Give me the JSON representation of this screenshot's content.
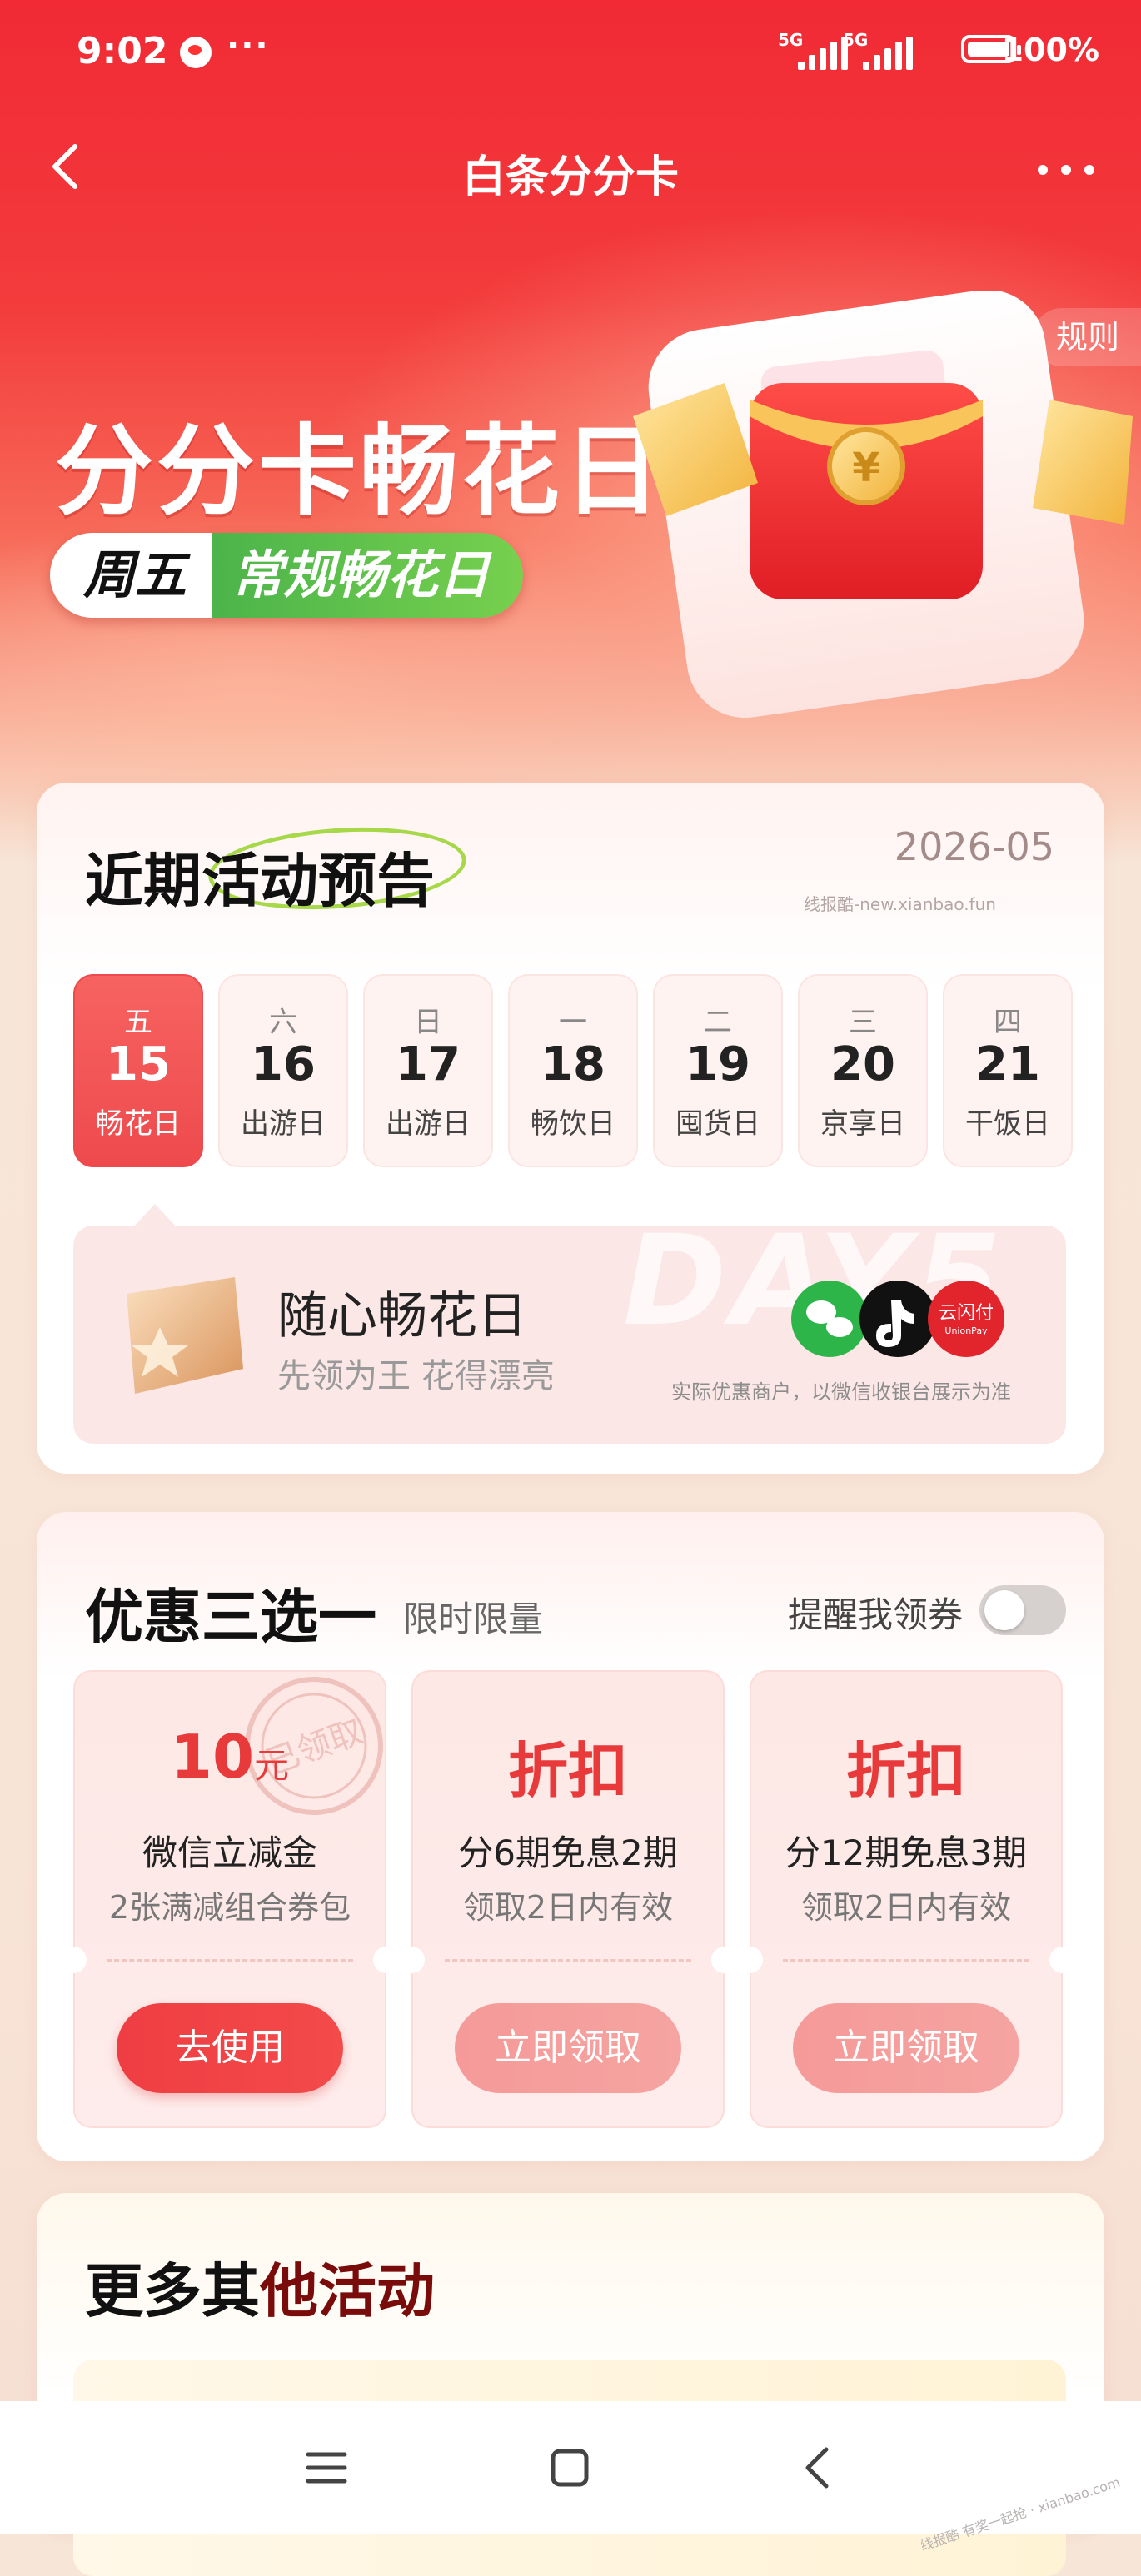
{
  "status_bar": {
    "time": "9:02",
    "more": "···",
    "signal_1": "5G",
    "signal_2": "5G",
    "battery": "100%"
  },
  "header": {
    "title": "白条分分卡",
    "rules_label": "规则"
  },
  "hero": {
    "title": "分分卡畅花日",
    "tag_day": "周五",
    "tag_type": "常规畅花日",
    "colors": {
      "brand_red": "#f12a35",
      "tag_green": "#4bb44a"
    }
  },
  "schedule": {
    "title_a": "近期",
    "title_b": "活动预告",
    "month": "2026-05",
    "watermark": "线报酷-new.xianbao.fun",
    "days": [
      {
        "weekday": "五",
        "date": "15",
        "name": "畅花日",
        "active": true
      },
      {
        "weekday": "六",
        "date": "16",
        "name": "出游日"
      },
      {
        "weekday": "日",
        "date": "17",
        "name": "出游日"
      },
      {
        "weekday": "一",
        "date": "18",
        "name": "畅饮日"
      },
      {
        "weekday": "二",
        "date": "19",
        "name": "囤货日"
      },
      {
        "weekday": "三",
        "date": "20",
        "name": "京享日"
      },
      {
        "weekday": "四",
        "date": "21",
        "name": "干饭日"
      }
    ],
    "feature": {
      "bg_text": "DAY5",
      "title": "随心畅花日",
      "subtitle": "先领为王 花得漂亮",
      "note": "实际优惠商户，以微信收银台展示为准",
      "pay_icons": [
        "wechat-pay-icon",
        "douyin-icon",
        "unionpay-icon"
      ],
      "unionpay_text": "云闪付",
      "unionpay_sub": "UnionPay"
    }
  },
  "offers": {
    "title": "优惠三选一",
    "limit": "限时限量",
    "remind_label": "提醒我领券",
    "remind_on": false,
    "stamp_text": "已领取",
    "coupons": [
      {
        "amount": "10",
        "unit": "元",
        "title": "微信立减金",
        "subtitle": "2张满减组合券包",
        "button": "去使用",
        "claimed": true
      },
      {
        "amount": "折扣",
        "unit": "",
        "title": "分6期免息2期",
        "subtitle": "领取2日内有效",
        "button": "立即领取",
        "claimed": false
      },
      {
        "amount": "折扣",
        "unit": "",
        "title": "分12期免息3期",
        "subtitle": "领取2日内有效",
        "button": "立即领取",
        "claimed": false
      }
    ]
  },
  "more_activities": {
    "title_a": "更多其",
    "title_b": "他活动"
  },
  "corner_watermark": "线报酷 有奖一起抢 · xianbao.com"
}
